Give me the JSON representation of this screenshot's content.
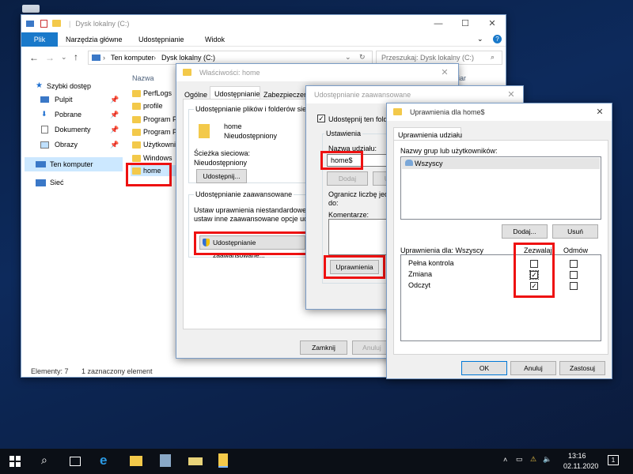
{
  "desktop": {
    "recycle_bin": ""
  },
  "explorer": {
    "title": "Dysk lokalny (C:)",
    "ribbon_tabs": [
      "Plik",
      "Narzędzia główne",
      "Udostępnianie",
      "Widok"
    ],
    "breadcrumb": [
      "Ten komputer",
      "Dysk lokalny (C:)"
    ],
    "search_placeholder": "Przeszukaj: Dysk lokalny (C:)",
    "column_name": "Nazwa",
    "column_modified": "zmiar",
    "quick_access": "Szybki dostęp",
    "nav_items": [
      "Pulpit",
      "Pobrane",
      "Dokumenty",
      "Obrazy"
    ],
    "this_pc": "Ten komputer",
    "network": "Sieć",
    "files": [
      "PerfLogs",
      "profile",
      "Program F",
      "Program F",
      "Użytkowni",
      "Windows",
      "home"
    ],
    "status_count": "Elementy: 7",
    "status_selected": "1 zaznaczony element"
  },
  "props": {
    "title": "Właściwości: home",
    "tabs": [
      "Ogólne",
      "Udostępnianie",
      "Zabezpieczenia"
    ],
    "section1": "Udostępnianie plików i folderów sieciowych",
    "folder_name": "home",
    "folder_status": "Nieudostępniony",
    "path_label": "Ścieżka sieciowa:",
    "path_value": "Nieudostępniony",
    "share_btn": "Udostępnij...",
    "section2": "Udostępnianie zaawansowane",
    "adv_text1": "Ustaw uprawnienia niestandardowe, ut",
    "adv_text2": "ustaw inne zaawansowane opcje udos",
    "adv_btn": "Udostępnianie zaawansowane...",
    "close": "Zamknij",
    "cancel": "Anuluj"
  },
  "adv": {
    "title": "Udostępnianie zaawansowane",
    "share_check": "Udostępnij ten folder",
    "settings": "Ustawienia",
    "share_name_label": "Nazwa udziału:",
    "share_name": "home$",
    "add": "Dodaj",
    "remove": "Us",
    "limit1": "Ogranicz liczbę jedn",
    "limit2": "do:",
    "comment": "Komentarze:",
    "perm_btn": "Uprawnienia"
  },
  "perm": {
    "title": "Uprawnienia dla home$",
    "tab": "Uprawnienia udziału",
    "groups_label": "Nazwy grup lub użytkowników:",
    "everyone": "Wszyscy",
    "add": "Dodaj...",
    "remove": "Usuń",
    "perm_for": "Uprawnienia dla: Wszyscy",
    "allow": "Zezwalaj",
    "deny": "Odmów",
    "rows": [
      {
        "name": "Pełna kontrola",
        "allow": false,
        "deny": false
      },
      {
        "name": "Zmiana",
        "allow": true,
        "deny": false
      },
      {
        "name": "Odczyt",
        "allow": true,
        "deny": false
      }
    ],
    "ok": "OK",
    "cancel": "Anuluj",
    "apply": "Zastosuj"
  },
  "taskbar": {
    "time": "13:16",
    "date": "02.11.2020",
    "notif_count": "1"
  }
}
